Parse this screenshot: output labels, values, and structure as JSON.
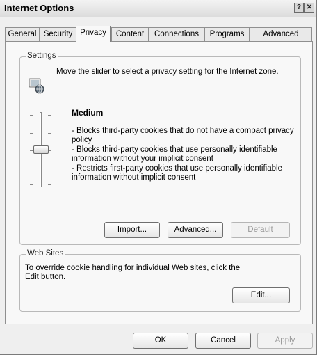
{
  "window": {
    "title": "Internet Options",
    "help_glyph": "?",
    "close_glyph": "✕"
  },
  "tabs": [
    {
      "label": "General"
    },
    {
      "label": "Security"
    },
    {
      "label": "Privacy"
    },
    {
      "label": "Content"
    },
    {
      "label": "Connections"
    },
    {
      "label": "Programs"
    },
    {
      "label": "Advanced"
    }
  ],
  "active_tab": "Privacy",
  "settings": {
    "legend": "Settings",
    "instruction": "Move the slider to select a privacy setting for the Internet zone.",
    "level": "Medium",
    "slider_position_fraction": 0.5,
    "description": [
      "- Blocks third-party cookies that do not have a compact privacy policy",
      "- Blocks third-party cookies that use personally identifiable information without your implicit consent",
      "- Restricts first-party cookies that use personally identifiable information without implicit consent"
    ],
    "buttons": {
      "import": "Import...",
      "advanced": "Advanced...",
      "default": "Default"
    }
  },
  "websites": {
    "legend": "Web Sites",
    "text": "To override cookie handling for individual Web sites, click the Edit button.",
    "edit": "Edit..."
  },
  "footer": {
    "ok": "OK",
    "cancel": "Cancel",
    "apply": "Apply"
  }
}
